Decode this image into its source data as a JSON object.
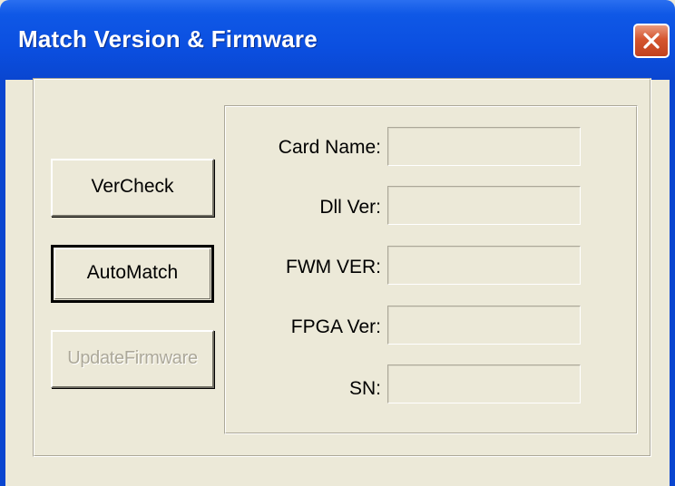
{
  "window": {
    "title": "Match Version & Firmware",
    "close_icon": "close-x-icon"
  },
  "buttons": {
    "vercheck": "VerCheck",
    "automatch": "AutoMatch",
    "update_firmware": "UpdateFirmware"
  },
  "fields": [
    {
      "label": "Card Name:",
      "value": ""
    },
    {
      "label": "Dll Ver:",
      "value": ""
    },
    {
      "label": "FWM VER:",
      "value": ""
    },
    {
      "label": "FPGA Ver:",
      "value": ""
    },
    {
      "label": "SN:",
      "value": ""
    }
  ],
  "colors": {
    "titlebar": "#0a46d0",
    "dialog_bg": "#ece9d8",
    "close_button": "#d5552f"
  }
}
